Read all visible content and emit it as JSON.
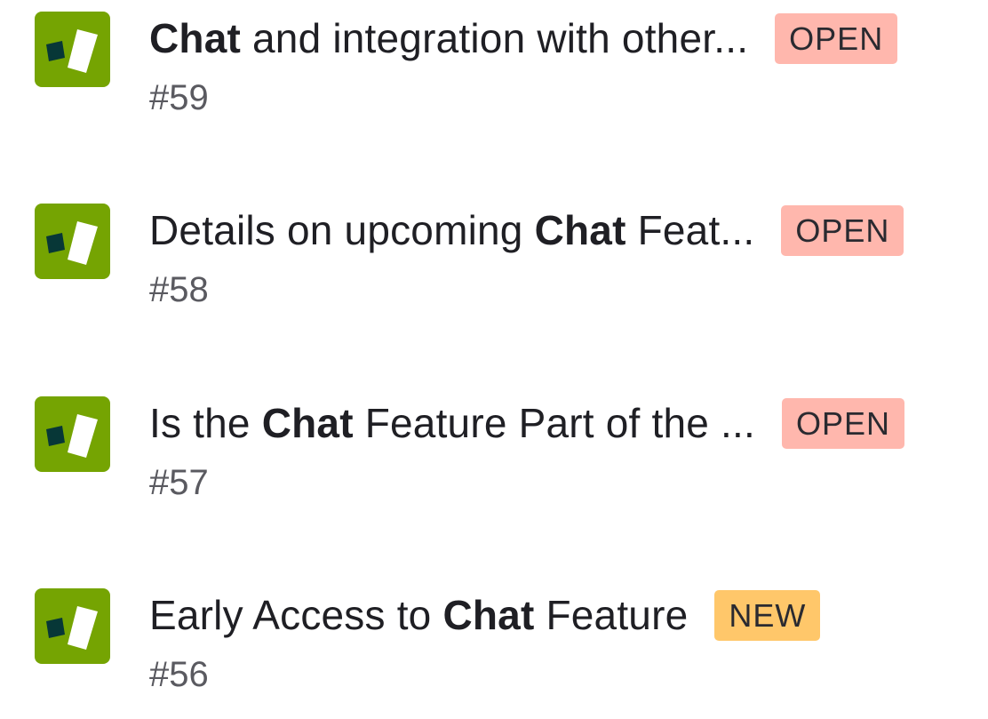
{
  "colors": {
    "icon_bg": "#75a402",
    "icon_square": "#073737",
    "open_badge": "#ffb7ad",
    "new_badge": "#ffc76a"
  },
  "items": [
    {
      "icon": "app-logo-icon",
      "title_pre": "",
      "title_bold": "Chat",
      "title_post": " and integration with other...",
      "badge": "OPEN",
      "number": "#59"
    },
    {
      "icon": "app-logo-icon",
      "title_pre": "Details on upcoming ",
      "title_bold": "Chat",
      "title_post": " Feat...",
      "badge": "OPEN",
      "number": "#58"
    },
    {
      "icon": "app-logo-icon",
      "title_pre": "Is the ",
      "title_bold": "Chat",
      "title_post": " Feature Part of the ...",
      "badge": "OPEN",
      "number": "#57"
    },
    {
      "icon": "app-logo-icon",
      "title_pre": "Early Access to ",
      "title_bold": "Chat",
      "title_post": " Feature",
      "badge": "NEW",
      "number": "#56"
    }
  ]
}
